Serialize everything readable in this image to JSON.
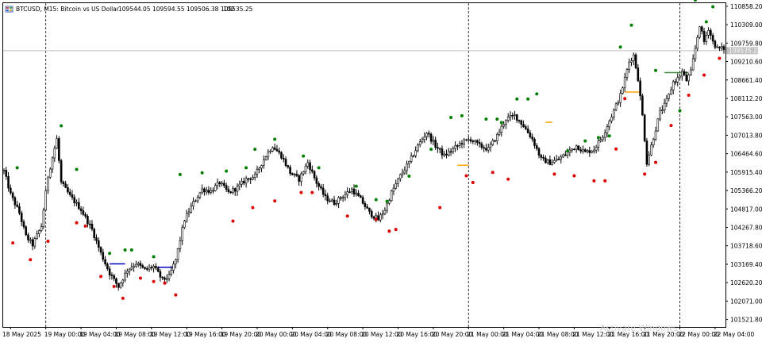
{
  "header": {
    "symbol_info": "BTCUSD, M15:  Bitcoin vs US Dollar",
    "ohlc": "109544.05  109594.55  109506.38  109535.25",
    "tick_volume": "102"
  },
  "watermark": "Activate Windows",
  "current_price_label": "109535.25",
  "colors": {
    "candle": "#000000",
    "fractal_up": "#008000",
    "fractal_down": "#e00000",
    "level_blue": "#0000c8",
    "level_orange": "#ffa500",
    "level_green": "#3c8c3c",
    "grid": "#000000",
    "price_line": "#c0c0c0"
  },
  "chart_data": {
    "type": "candlestick",
    "title": "BTCUSD, M15:  Bitcoin vs US Dollar",
    "y_ticks": [
      "110858.20",
      "110309.00",
      "109759.80",
      "109210.60",
      "108661.40",
      "108112.20",
      "107563.00",
      "107013.80",
      "106464.60",
      "105915.40",
      "105366.20",
      "104817.00",
      "104267.80",
      "103718.60",
      "103169.40",
      "102620.20",
      "102071.00",
      "101521.80"
    ],
    "y_tick_values": [
      110858.2,
      110309.0,
      109759.8,
      109210.6,
      108661.4,
      108112.2,
      107563.0,
      107013.8,
      106464.6,
      105915.4,
      105366.2,
      104817.0,
      104267.8,
      103718.6,
      103169.4,
      102620.2,
      102071.0,
      101521.8
    ],
    "x_ticks": [
      "18 May 2025",
      "19 May 00:00",
      "19 May 04:00",
      "19 May 08:00",
      "19 May 12:00",
      "19 May 16:00",
      "19 May 20:00",
      "20 May 00:00",
      "20 May 04:00",
      "20 May 08:00",
      "20 May 12:00",
      "20 May 16:00",
      "20 May 20:00",
      "21 May 00:00",
      "21 May 04:00",
      "21 May 08:00",
      "21 May 12:00",
      "21 May 16:00",
      "21 May 20:00",
      "22 May 00:00",
      "22 May 04:00"
    ],
    "ylim": [
      101300,
      110950
    ],
    "current_price": 109535.25,
    "day_separators": [
      "19 May 00:00",
      "21 May 00:00",
      "22 May 00:00"
    ],
    "grid": false,
    "anchors": [
      [
        0,
        105950
      ],
      [
        3,
        105250
      ],
      [
        7,
        104700
      ],
      [
        10,
        104000
      ],
      [
        13,
        103750
      ],
      [
        17,
        104300
      ],
      [
        20,
        105800
      ],
      [
        24,
        106900
      ],
      [
        26,
        105600
      ],
      [
        30,
        105200
      ],
      [
        35,
        104800
      ],
      [
        40,
        104200
      ],
      [
        44,
        103500
      ],
      [
        48,
        102900
      ],
      [
        52,
        102500
      ],
      [
        56,
        103000
      ],
      [
        60,
        103200
      ],
      [
        64,
        103000
      ],
      [
        68,
        103100
      ],
      [
        72,
        102700
      ],
      [
        75,
        102800
      ],
      [
        78,
        103300
      ],
      [
        82,
        104500
      ],
      [
        86,
        105000
      ],
      [
        90,
        105400
      ],
      [
        94,
        105350
      ],
      [
        98,
        105600
      ],
      [
        102,
        105300
      ],
      [
        106,
        105450
      ],
      [
        110,
        105700
      ],
      [
        114,
        105800
      ],
      [
        118,
        106300
      ],
      [
        122,
        106700
      ],
      [
        126,
        106400
      ],
      [
        130,
        105900
      ],
      [
        134,
        105700
      ],
      [
        138,
        106200
      ],
      [
        142,
        105600
      ],
      [
        146,
        105150
      ],
      [
        150,
        105000
      ],
      [
        154,
        105200
      ],
      [
        158,
        105400
      ],
      [
        162,
        105100
      ],
      [
        166,
        104700
      ],
      [
        170,
        104500
      ],
      [
        173,
        104800
      ],
      [
        176,
        105300
      ],
      [
        180,
        105800
      ],
      [
        184,
        106200
      ],
      [
        188,
        106700
      ],
      [
        192,
        107100
      ],
      [
        196,
        106700
      ],
      [
        200,
        106400
      ],
      [
        204,
        106600
      ],
      [
        208,
        106800
      ],
      [
        212,
        106900
      ],
      [
        216,
        106700
      ],
      [
        220,
        106600
      ],
      [
        224,
        107000
      ],
      [
        228,
        107500
      ],
      [
        232,
        107600
      ],
      [
        236,
        107300
      ],
      [
        240,
        106900
      ],
      [
        244,
        106300
      ],
      [
        248,
        106200
      ],
      [
        252,
        106300
      ],
      [
        256,
        106500
      ],
      [
        260,
        106700
      ],
      [
        264,
        106500
      ],
      [
        268,
        106600
      ],
      [
        272,
        107000
      ],
      [
        276,
        107600
      ],
      [
        280,
        108200
      ],
      [
        284,
        109200
      ],
      [
        286,
        109400
      ],
      [
        288,
        108700
      ],
      [
        290,
        107600
      ],
      [
        292,
        106200
      ],
      [
        294,
        106700
      ],
      [
        296,
        107200
      ],
      [
        298,
        107700
      ],
      [
        300,
        107900
      ],
      [
        302,
        108200
      ],
      [
        304,
        108600
      ],
      [
        306,
        108700
      ],
      [
        308,
        108900
      ],
      [
        310,
        108650
      ],
      [
        312,
        108900
      ],
      [
        314,
        109600
      ],
      [
        316,
        110300
      ],
      [
        318,
        109800
      ],
      [
        320,
        110200
      ],
      [
        322,
        109800
      ],
      [
        324,
        109600
      ]
    ],
    "fractals_up": [
      [
        6,
        105950
      ],
      [
        26,
        107200
      ],
      [
        33,
        105900
      ],
      [
        48,
        103400
      ],
      [
        55,
        103500
      ],
      [
        58,
        103500
      ],
      [
        68,
        103300
      ],
      [
        80,
        105750
      ],
      [
        90,
        105800
      ],
      [
        101,
        105850
      ],
      [
        110,
        105950
      ],
      [
        114,
        106500
      ],
      [
        123,
        106800
      ],
      [
        136,
        106300
      ],
      [
        143,
        105950
      ],
      [
        160,
        105400
      ],
      [
        169,
        105000
      ],
      [
        174,
        104950
      ],
      [
        184,
        105700
      ],
      [
        194,
        106500
      ],
      [
        203,
        107450
      ],
      [
        208,
        107500
      ],
      [
        219,
        107400
      ],
      [
        224,
        107400
      ],
      [
        226,
        107300
      ],
      [
        233,
        108000
      ],
      [
        238,
        108000
      ],
      [
        242,
        108150
      ],
      [
        256,
        106450
      ],
      [
        264,
        106750
      ],
      [
        270,
        106850
      ],
      [
        275,
        106900
      ],
      [
        280,
        109550
      ],
      [
        285,
        110200
      ],
      [
        296,
        108850
      ],
      [
        307,
        107650
      ],
      [
        314,
        110950
      ],
      [
        319,
        110300
      ],
      [
        322,
        110750
      ]
    ],
    "fractals_down": [
      [
        4,
        103900
      ],
      [
        12,
        103400
      ],
      [
        20,
        103950
      ],
      [
        33,
        104500
      ],
      [
        37,
        104400
      ],
      [
        44,
        102900
      ],
      [
        50,
        102600
      ],
      [
        54,
        102250
      ],
      [
        62,
        102850
      ],
      [
        68,
        102750
      ],
      [
        73,
        102700
      ],
      [
        78,
        102350
      ],
      [
        104,
        104550
      ],
      [
        113,
        104950
      ],
      [
        123,
        105150
      ],
      [
        135,
        105400
      ],
      [
        140,
        105400
      ],
      [
        156,
        104700
      ],
      [
        169,
        104600
      ],
      [
        175,
        104250
      ],
      [
        178,
        104300
      ],
      [
        198,
        104950
      ],
      [
        210,
        105900
      ],
      [
        213,
        105700
      ],
      [
        222,
        106000
      ],
      [
        229,
        105800
      ],
      [
        250,
        105950
      ],
      [
        259,
        105900
      ],
      [
        268,
        105750
      ],
      [
        273,
        105750
      ],
      [
        278,
        106700
      ],
      [
        282,
        108200
      ],
      [
        291,
        105950
      ],
      [
        296,
        106300
      ],
      [
        303,
        107400
      ],
      [
        311,
        108300
      ],
      [
        318,
        108900
      ],
      [
        325,
        109400
      ]
    ],
    "levels": [
      {
        "color": "level_blue",
        "from": 48,
        "to": 55,
        "price": 103180
      },
      {
        "color": "level_blue",
        "from": 70,
        "to": 77,
        "price": 103080
      },
      {
        "color": "level_orange",
        "from": 206,
        "to": 211,
        "price": 106120
      },
      {
        "color": "level_orange",
        "from": 246,
        "to": 249,
        "price": 107400
      },
      {
        "color": "level_orange",
        "from": 282,
        "to": 289,
        "price": 108300
      },
      {
        "color": "level_green",
        "from": 300,
        "to": 311,
        "price": 108880
      }
    ],
    "n_bars": 328
  }
}
